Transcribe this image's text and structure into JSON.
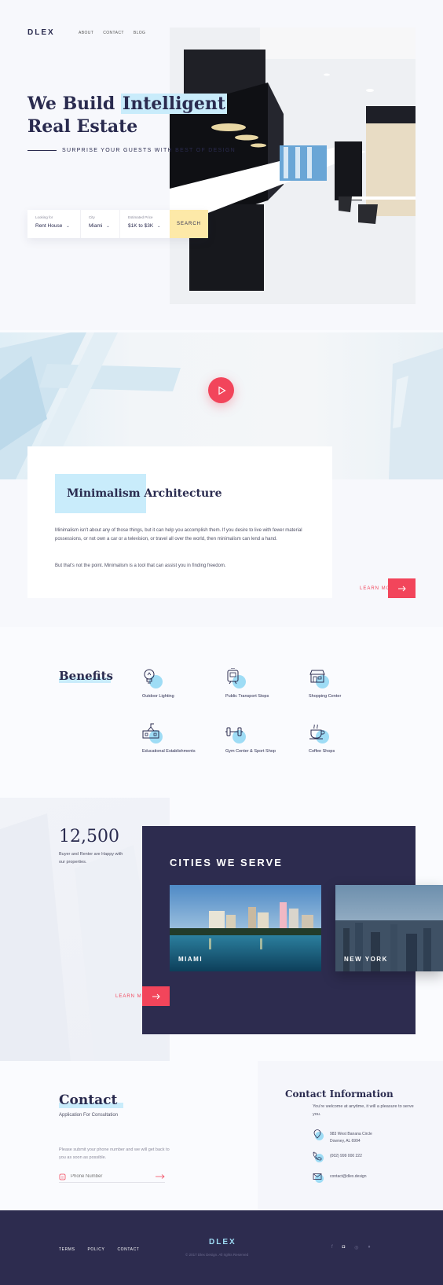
{
  "header": {
    "logo": "DLEX",
    "nav": [
      "ABOUT",
      "CONTACT",
      "BLOG"
    ]
  },
  "hero": {
    "title_pre": "We Build ",
    "title_highlight": "Intelligent",
    "title_line2": "Real Estate",
    "tagline": "SURPRISE YOUR GUESTS WITH BEST OF DESIGN",
    "search": {
      "looking_label": "Looking for",
      "looking_value": "Rent House",
      "city_label": "City",
      "city_value": "Miami",
      "price_label": "Estimated Price",
      "price_value": "$1K to $3K",
      "button": "SEARCH"
    }
  },
  "about": {
    "title": "Minimalism Architecture",
    "p1": "Minimalism isn't about any of those things, but it can help you accomplish them. If you desire to live with fewer material possessions, or not own a car or a television, or travel all over the world, then minimalism can lend a hand.",
    "p2": "But that's not the point. Minimalism is a tool that can assist you in finding freedom.",
    "learn_more": "LEARN MORE"
  },
  "benefits": {
    "title": "Benefits",
    "items": [
      {
        "label": "Outdoor Lighting",
        "icon": "lightbulb-icon"
      },
      {
        "label": "Public Transport Stops",
        "icon": "train-icon"
      },
      {
        "label": "Shopping Center",
        "icon": "store-icon"
      },
      {
        "label": "Educational Establishments",
        "icon": "school-icon"
      },
      {
        "label": "Gym Center & Sport Shop",
        "icon": "dumbbell-icon"
      },
      {
        "label": "Coffee Shops",
        "icon": "coffee-icon"
      }
    ]
  },
  "stats": {
    "number": "12,500",
    "description": "Buyer and Renter are Happy with our properties.",
    "learn_more": "LEARN MORE"
  },
  "cities": {
    "title": "CITIES WE SERVE",
    "items": [
      "MIAMI",
      "NEW YORK"
    ]
  },
  "contact": {
    "title": "Contact",
    "subtitle": "Application For Consultation",
    "description": "Please submit your phone number and we will get back to you as soon as possible.",
    "phone_placeholder": "Phone Number"
  },
  "contact_info": {
    "title": "Contact Information",
    "description": "You're welcome at anytime, it will a pleasure to serve you.",
    "address": "983 West Banana Circle Downey, AL 6994",
    "phone": "(002) 999 000 222",
    "email": "contact@dlex.design"
  },
  "footer": {
    "links": [
      "TERMS",
      "POLICY",
      "CONTACT"
    ],
    "logo": "DLEX",
    "copyright": "© 2017 Dlex Design. All rights Reserved",
    "social": [
      "facebook-icon",
      "instagram-icon",
      "dribbble-icon",
      "twitter-icon"
    ]
  },
  "colors": {
    "navy": "#2d2c4f",
    "accent": "#f2455b",
    "highlight": "#c9ecfb",
    "yellow": "#fde9a8"
  }
}
